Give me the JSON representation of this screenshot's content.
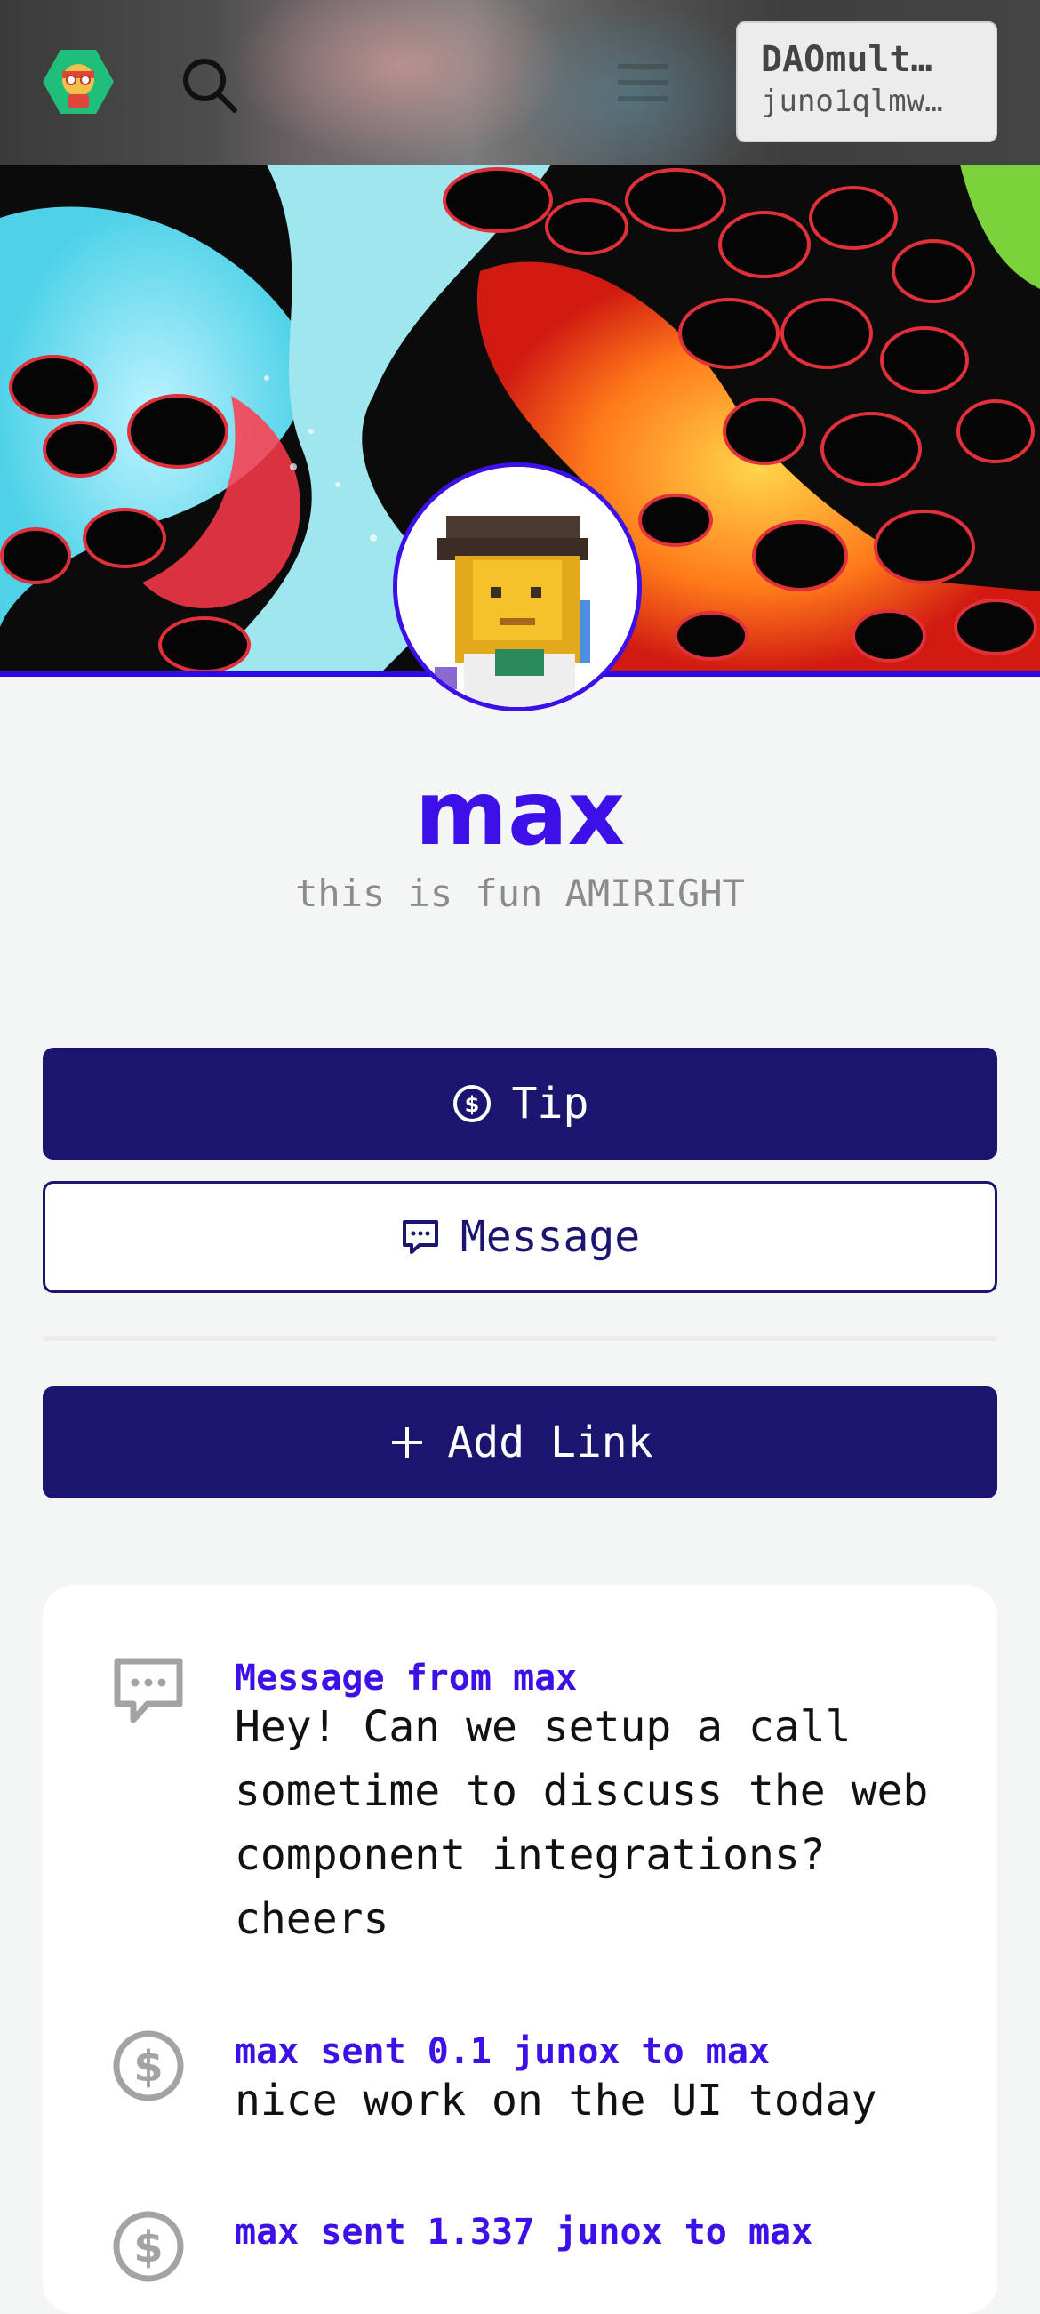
{
  "header": {
    "wallet_name": "DAOmult…",
    "wallet_address": "juno1qlmw…"
  },
  "profile": {
    "name": "max",
    "bio": "this is fun AMIRIGHT"
  },
  "actions": {
    "tip_label": "Tip",
    "message_label": "Message",
    "add_link_label": "Add Link"
  },
  "feed": [
    {
      "type": "message",
      "icon": "chat-icon",
      "title": "Message from max",
      "body": "Hey! Can we setup a call sometime to discuss the web component integrations? cheers"
    },
    {
      "type": "tip",
      "icon": "dollar-icon",
      "title": "max sent 0.1 junox to max",
      "body": "nice work on the UI today"
    },
    {
      "type": "tip",
      "icon": "dollar-icon",
      "title": "max sent 1.337 junox to max",
      "body": ""
    }
  ],
  "colors": {
    "accent": "#3c10e6",
    "primary_button": "#1c1570",
    "background": "#f4f5f5"
  }
}
